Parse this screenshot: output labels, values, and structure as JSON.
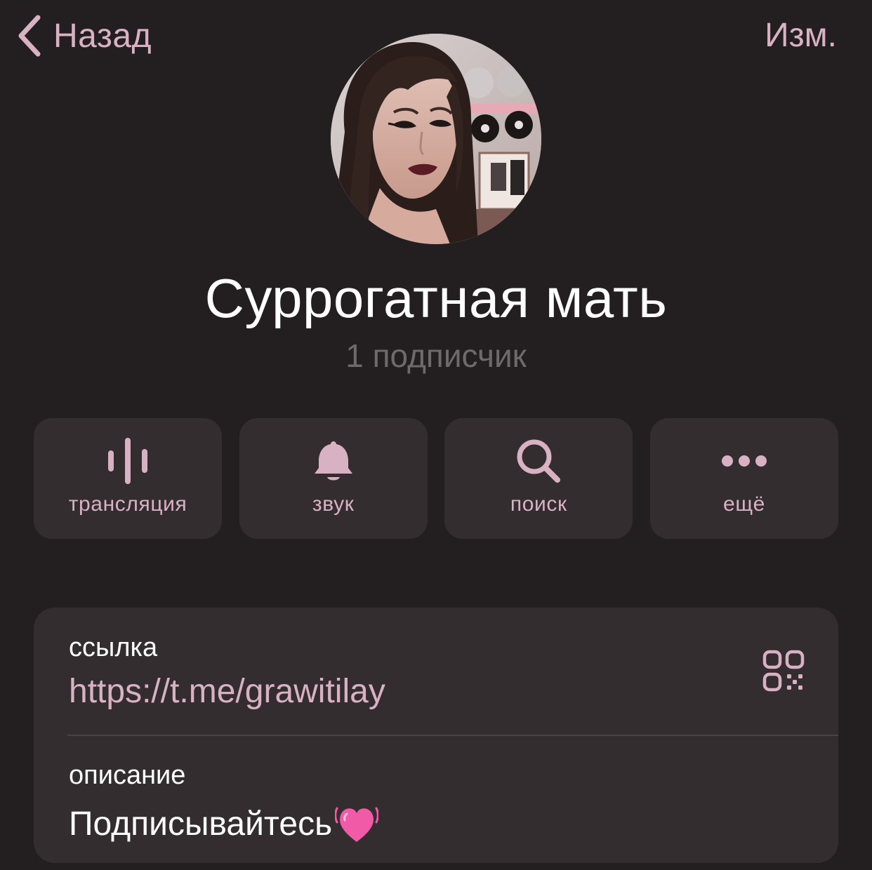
{
  "nav": {
    "back_label": "Назад",
    "edit_label": "Изм."
  },
  "channel": {
    "title": "Суррогатная мать",
    "subscribers": "1 подписчик"
  },
  "actions": [
    {
      "label": "трансляция",
      "icon": "waveform-icon"
    },
    {
      "label": "звук",
      "icon": "bell-icon"
    },
    {
      "label": "поиск",
      "icon": "search-icon"
    },
    {
      "label": "ещё",
      "icon": "more-dots-icon"
    }
  ],
  "info": {
    "link_label": "ссылка",
    "link_value": "https://t.me/grawitilay",
    "description_label": "описание",
    "description_value": "Подписывайтесь"
  },
  "colors": {
    "background": "#231f20",
    "card": "#342d2f",
    "accent": "#d8b2c2",
    "secondary_text": "#6e6a6b"
  }
}
